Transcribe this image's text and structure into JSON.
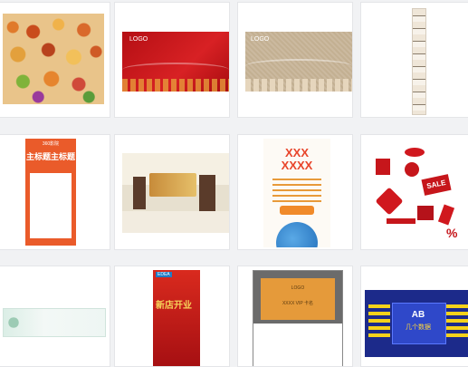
{
  "grid": {
    "items": [
      {
        "name": "thumb-food-collage"
      },
      {
        "name": "thumb-red-card",
        "logo": "LOGO"
      },
      {
        "name": "thumb-beige-card",
        "logo": "LOGO"
      },
      {
        "name": "thumb-long-strip"
      },
      {
        "name": "thumb-poster-headline",
        "top_label": "360影院",
        "headline": "主标题主标题"
      },
      {
        "name": "thumb-interior-room"
      },
      {
        "name": "thumb-xxx-poster",
        "line1": "XXX",
        "line2": "XXXX"
      },
      {
        "name": "thumb-red-tags",
        "sale": "SALE"
      },
      {
        "name": "thumb-watercolor-banner"
      },
      {
        "name": "thumb-red-vertical-poster",
        "brand": "EDEA",
        "title": "新店开业"
      },
      {
        "name": "thumb-orange-business-card",
        "logo": "LOGO",
        "line": "XXXX VIP 卡名"
      },
      {
        "name": "thumb-blue-tunnel",
        "line1": "AB",
        "line2": "几个数据"
      }
    ]
  },
  "colors": {
    "red": "#c6161b",
    "beige": "#c9b79c",
    "orange": "#e59a3a",
    "blue": "#1c2a8a"
  }
}
